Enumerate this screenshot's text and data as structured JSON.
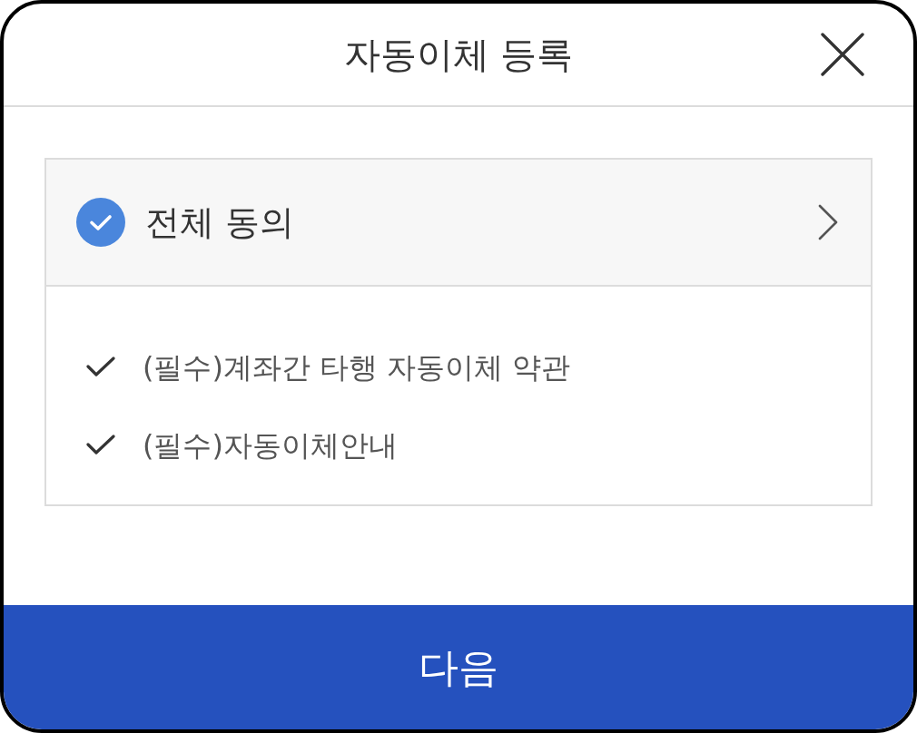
{
  "header": {
    "title": "자동이체 등록"
  },
  "agreement": {
    "all": {
      "label": "전체 동의",
      "checked": true
    },
    "items": [
      {
        "label": "(필수)계좌간 타행 자동이체 약관",
        "checked": true
      },
      {
        "label": "(필수)자동이체안내",
        "checked": true
      }
    ]
  },
  "next_button": {
    "label": "다음"
  }
}
